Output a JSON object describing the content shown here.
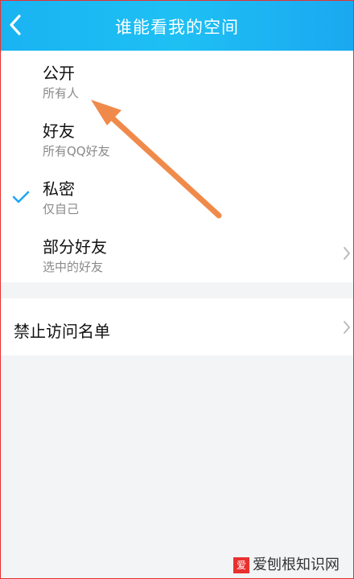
{
  "header": {
    "title": "谁能看我的空间",
    "back_icon": "chevron-left-icon"
  },
  "privacy_options": [
    {
      "title": "公开",
      "subtitle": "所有人",
      "selected": false,
      "has_chevron": false
    },
    {
      "title": "好友",
      "subtitle": "所有QQ好友",
      "selected": false,
      "has_chevron": false
    },
    {
      "title": "私密",
      "subtitle": "仅自己",
      "selected": true,
      "has_chevron": false
    },
    {
      "title": "部分好友",
      "subtitle": "选中的好友",
      "selected": false,
      "has_chevron": true
    }
  ],
  "blocklist": {
    "label": "禁止访问名单"
  },
  "watermark": {
    "text": "爱刨根知识网"
  },
  "colors": {
    "header": "#1ab6f2",
    "check": "#1ea6f5",
    "annotation_arrow": "#f08a4b",
    "page_bg": "#f3f4f6"
  }
}
